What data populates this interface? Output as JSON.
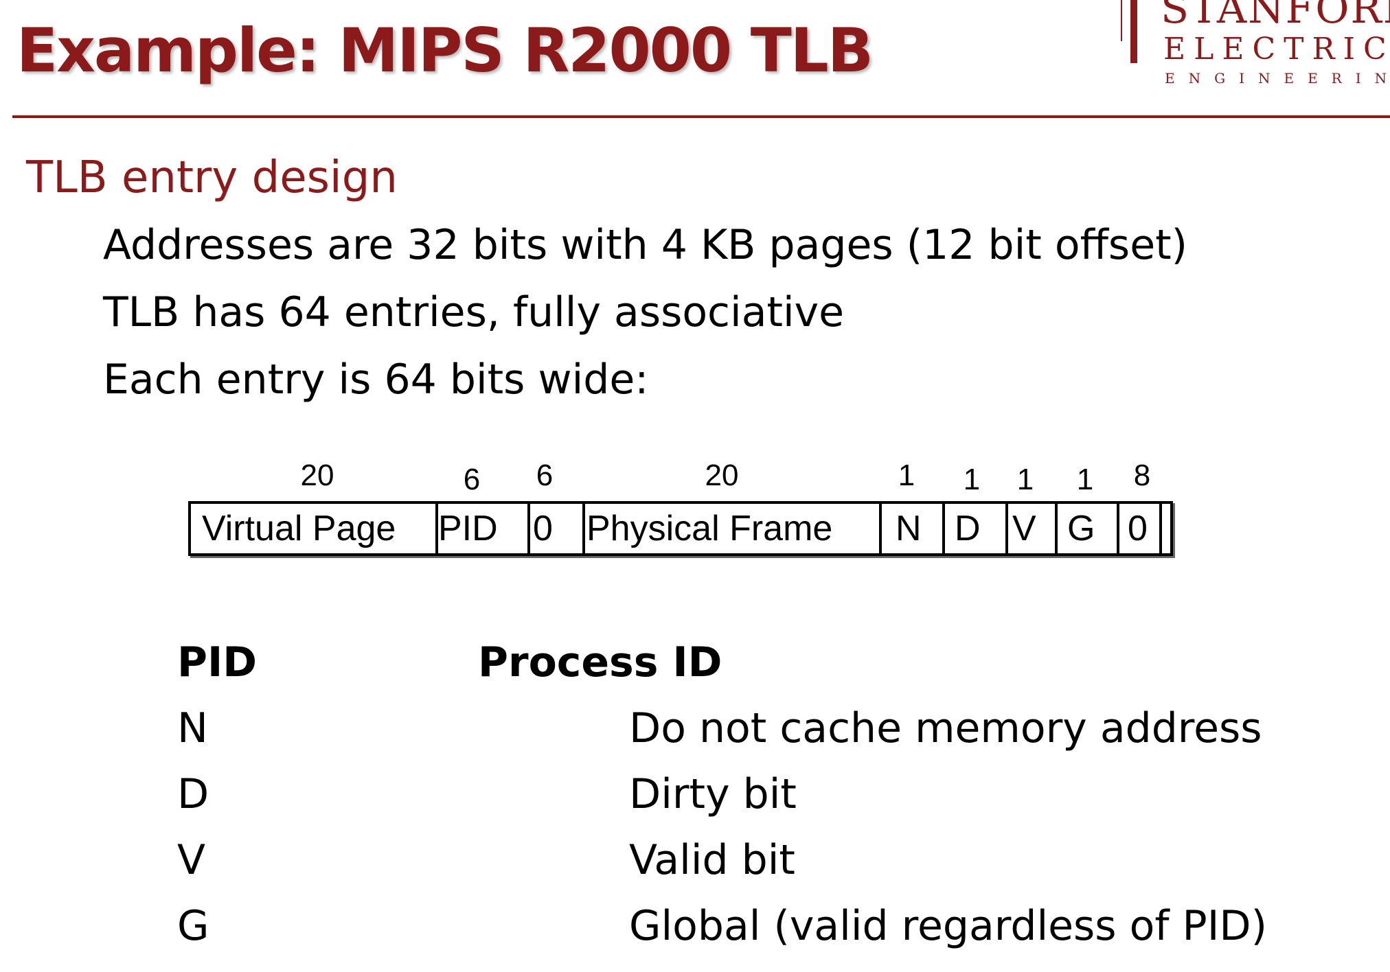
{
  "slide": {
    "title": "Example: MIPS R2000 TLB",
    "subtitle": "TLB entry design",
    "bullets": [
      "Addresses are 32 bits with 4 KB pages (12 bit offset)",
      "TLB has 64 entries, fully associative",
      "Each entry is 64 bits wide:"
    ]
  },
  "logo": {
    "line1": "STANFORD",
    "line2": "ELECTRICAL",
    "line3": "ENGINEERING"
  },
  "tlb_entry": {
    "widths": [
      "20",
      "6",
      "6",
      "20",
      "1",
      "1",
      "1",
      "1",
      "8"
    ],
    "fields": [
      "Virtual Page",
      "PID",
      "0",
      "Physical Frame",
      "N",
      "D",
      "V",
      "G",
      "0"
    ]
  },
  "definitions": [
    {
      "key": "PID",
      "value": "Process ID"
    },
    {
      "key": "N",
      "value": "Do not cache memory address"
    },
    {
      "key": "D",
      "value": "Dirty bit"
    },
    {
      "key": "V",
      "value": "Valid bit"
    },
    {
      "key": "G",
      "value": "Global (valid regardless of PID)"
    }
  ],
  "colors": {
    "accent": "#8b1a1a",
    "text": "#000000",
    "background": "#ffffff"
  }
}
